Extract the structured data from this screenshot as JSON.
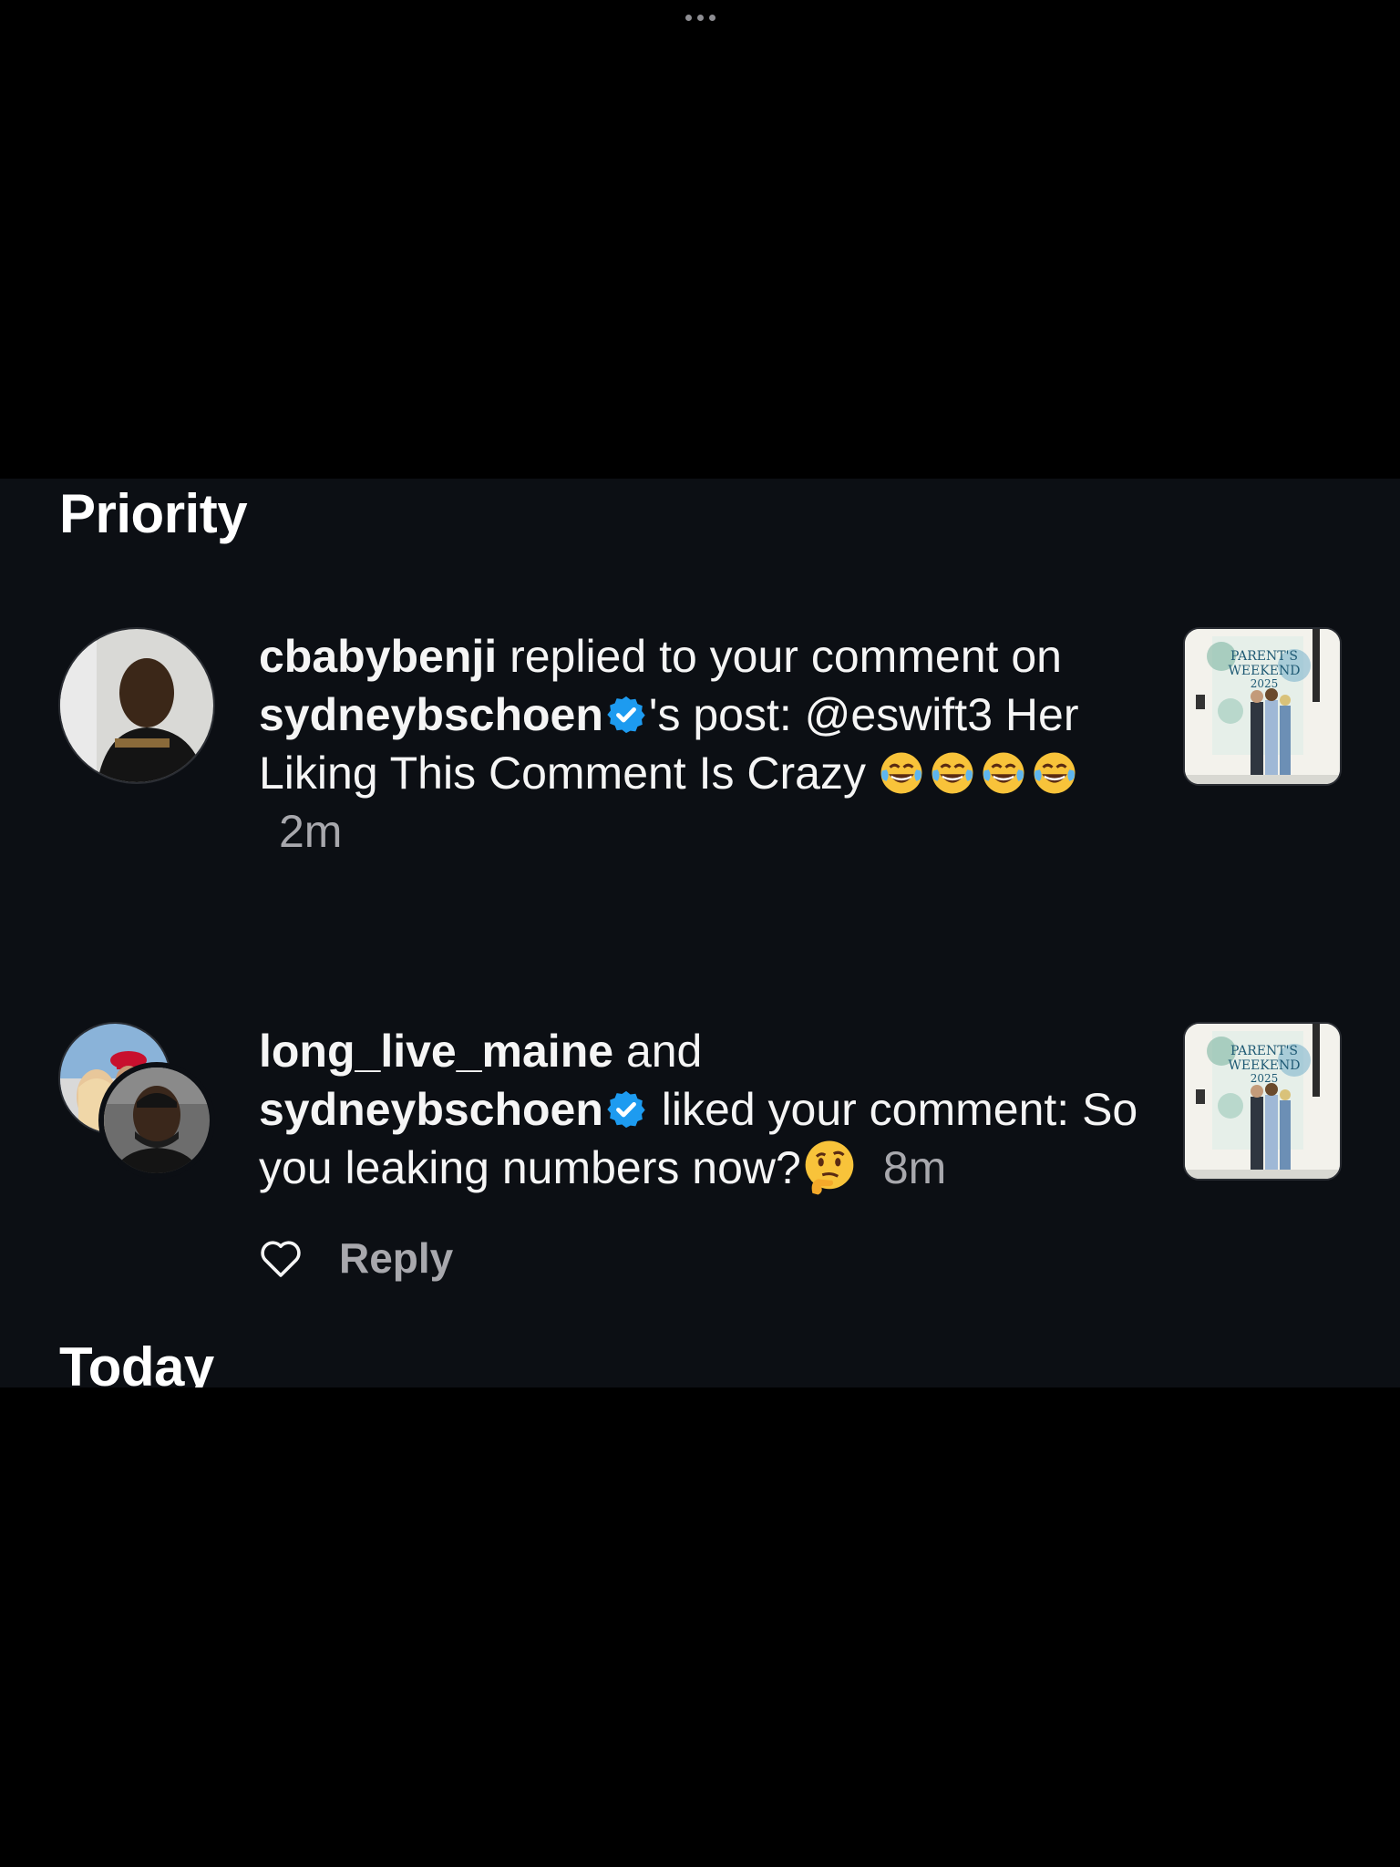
{
  "sections": {
    "priority": "Priority",
    "today": "Today"
  },
  "notifications": [
    {
      "user": "cbabybenji",
      "text_1": " replied to your comment on ",
      "mention_user": "sydneybschoen",
      "text_2": "'s post: @eswift3 Her Liking This Comment Is Crazy ",
      "emoji": "face-with-tears-of-joy x4",
      "time": "2m",
      "thumbnail_caption": "PARENT'S WEEKEND 2025"
    },
    {
      "user_1": "long_live_maine",
      "text_and": " and",
      "user_2": "sydneybschoen",
      "text_1": " liked your comment: So you leaking numbers now?",
      "emoji": "thinking-face",
      "time": "8m",
      "thumbnail_caption": "PARENT'S WEEKEND 2025"
    }
  ],
  "actions": {
    "reply_label": "Reply",
    "like_icon": "heart-outline-icon"
  },
  "colors": {
    "panel_bg": "#0c0f14",
    "verified_blue": "#1d9bf0",
    "muted_text": "#a8a8ad"
  }
}
